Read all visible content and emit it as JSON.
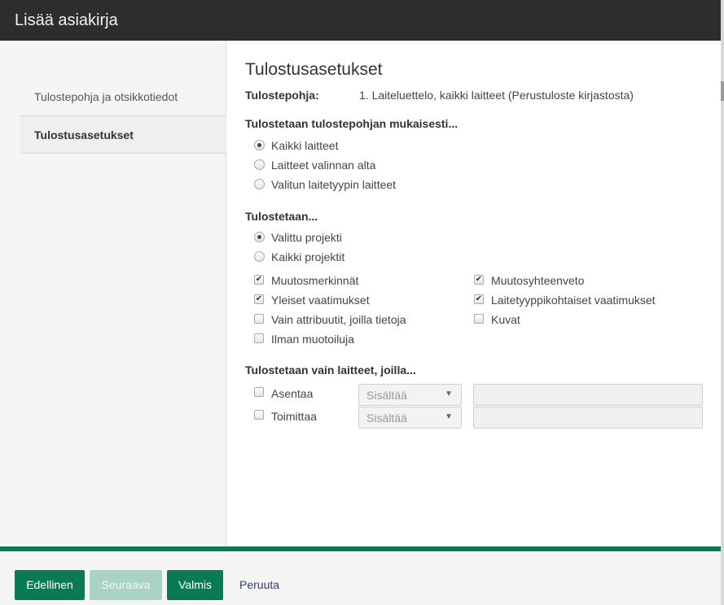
{
  "dialog": {
    "title": "Lisää asiakirja"
  },
  "sidebar": {
    "items": [
      {
        "label": "Tulostepohja ja otsikkotiedot",
        "active": false
      },
      {
        "label": "Tulostusasetukset",
        "active": true
      }
    ]
  },
  "content": {
    "heading": "Tulostusasetukset",
    "template_label": "Tulostepohja:",
    "template_value": "1. Laiteluettelo, kaikki laitteet (Perustuloste kirjastosta)",
    "section1": {
      "title": "Tulostetaan tulostepohjan mukaisesti...",
      "options": [
        {
          "label": "Kaikki laitteet",
          "selected": true
        },
        {
          "label": "Laitteet valinnan alta",
          "selected": false
        },
        {
          "label": "Valitun laitetyypin laitteet",
          "selected": false
        }
      ]
    },
    "section2": {
      "title": "Tulostetaan...",
      "options": [
        {
          "label": "Valittu projekti",
          "selected": true
        },
        {
          "label": "Kaikki projektit",
          "selected": false
        }
      ],
      "checkboxes": [
        {
          "label": "Muutosmerkinnät",
          "checked": true
        },
        {
          "label": "Muutosyhteenveto",
          "checked": true
        },
        {
          "label": "Yleiset vaatimukset",
          "checked": true
        },
        {
          "label": "Laitetyyppikohtaiset vaatimukset",
          "checked": true
        },
        {
          "label": "Vain attribuutit, joilla tietoja",
          "checked": false
        },
        {
          "label": "Kuvat",
          "checked": false
        },
        {
          "label": "Ilman muotoiluja",
          "checked": false
        }
      ]
    },
    "section3": {
      "title": "Tulostetaan vain laitteet, joilla...",
      "filters": [
        {
          "label": "Asentaa",
          "checked": false,
          "operator": "Sisältää",
          "value": ""
        },
        {
          "label": "Toimittaa",
          "checked": false,
          "operator": "Sisältää",
          "value": ""
        }
      ]
    }
  },
  "footer": {
    "prev_label": "Edellinen",
    "next_label": "Seuraava",
    "done_label": "Valmis",
    "cancel_label": "Peruuta"
  },
  "colors": {
    "accent": "#0a7a55",
    "disabled_accent": "#a9d4c5",
    "titlebar": "#2d2d2d",
    "link": "#2a3f7a"
  }
}
